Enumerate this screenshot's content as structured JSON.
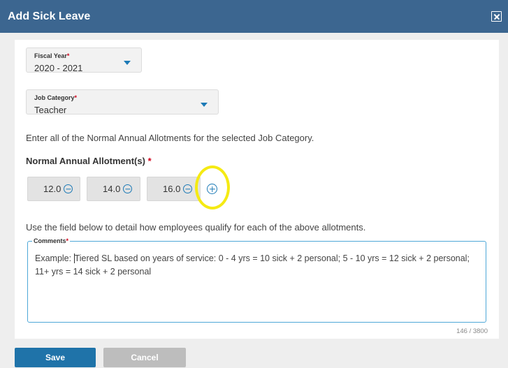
{
  "dialog": {
    "title": "Add Sick Leave"
  },
  "fiscal_year": {
    "label": "Fiscal Year",
    "required_mark": "*",
    "value": "2020 - 2021"
  },
  "job_category": {
    "label": "Job Category",
    "required_mark": "*",
    "value": "Teacher"
  },
  "instructions": {
    "allotments": "Enter all of the Normal Annual Allotments for the selected Job Category.",
    "comments": "Use the field below to detail how employees qualify for each of the above allotments."
  },
  "allotments": {
    "heading": "Normal Annual Allotment(s)",
    "required_mark": "*",
    "items": [
      {
        "value": "12.0"
      },
      {
        "value": "14.0"
      },
      {
        "value": "16.0"
      }
    ]
  },
  "comments": {
    "label": "Comments",
    "required_mark": "*",
    "prefix": "Example: ",
    "text": "Tiered SL based on years of service:  0 - 4 yrs = 10 sick + 2 personal; 5 - 10 yrs = 12 sick + 2 personal; 11+ yrs = 14 sick + 2 personal",
    "char_count": "146 / 3800"
  },
  "buttons": {
    "save": "Save",
    "cancel": "Cancel"
  },
  "colors": {
    "header": "#3c6690",
    "accent": "#1c7ab6",
    "highlight": "#f5ea13"
  },
  "icons": {
    "close": "close-icon",
    "remove": "minus-circle-icon",
    "add": "plus-circle-icon",
    "caret": "chevron-down-icon"
  }
}
